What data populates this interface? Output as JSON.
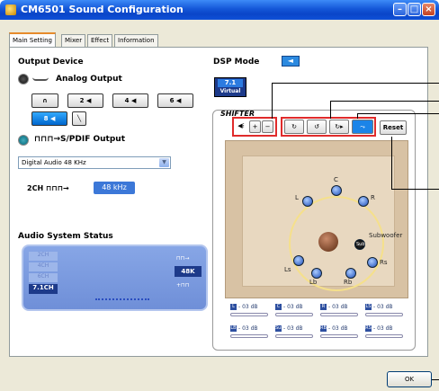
{
  "window": {
    "title": "CM6501 Sound Configuration"
  },
  "tabs": [
    {
      "label": "Main Setting"
    },
    {
      "label": "Mixer"
    },
    {
      "label": "Effect"
    },
    {
      "label": "Information"
    }
  ],
  "output": {
    "title": "Output Device",
    "analog_label": "Analog Output",
    "spdif_label": "S/PDIF Output",
    "speaker_buttons": [
      "2",
      "4",
      "6",
      "8"
    ],
    "spdif_select": "Digital Audio 48 KHz",
    "spdif_2ch": "2CH",
    "spdif_rate": "48 kHz"
  },
  "status": {
    "title": "Audio System Status",
    "rows": [
      "2CH",
      "4CH",
      "6CH",
      "7.1CH"
    ],
    "active_row": "7.1CH",
    "rate": "48K"
  },
  "dsp": {
    "title": "DSP Mode",
    "badge_top": "7.1",
    "badge_bottom": "Virtual",
    "shifter": "SHIFTER",
    "reset": "Reset",
    "speakers": {
      "c": "C",
      "l": "L",
      "r": "R",
      "ls": "Ls",
      "rs": "Rs",
      "lb": "Lb",
      "rb": "Rb",
      "sub": "Sub",
      "subwoofer": "Subwoofer"
    },
    "levels": [
      {
        "badge": "L",
        "text": "- 03 dB"
      },
      {
        "badge": "C",
        "text": "- 03 dB"
      },
      {
        "badge": "R",
        "text": "- 03 dB"
      },
      {
        "badge": "LS",
        "text": "- 03 dB"
      },
      {
        "badge": "LB",
        "text": "- 03 dB"
      },
      {
        "badge": "Sub",
        "text": "- 03 dB"
      },
      {
        "badge": "RB",
        "text": "- 03 dB"
      },
      {
        "badge": "RS",
        "text": "- 03 dB"
      }
    ]
  },
  "footer": {
    "ok": "OK"
  },
  "colors": {
    "titlebar": "#0a45c8",
    "accent_blue": "#0066cc",
    "highlight_red": "#e02b2b"
  }
}
